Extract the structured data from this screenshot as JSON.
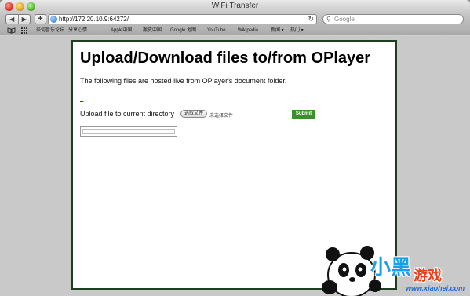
{
  "window": {
    "title": "WiFi Transfer"
  },
  "toolbar": {
    "url": "http://172.20.10.9:64272/",
    "search_placeholder": "Google",
    "add_label": "+"
  },
  "bookmarks": [
    "奈何音乐论坛...分享心情......",
    "Apple中国",
    "搬皮中国",
    "Google 地图",
    "YouTube",
    "Wikipedia",
    "新闻 ▾",
    "热门 ▾"
  ],
  "page": {
    "heading": "Upload/Download files to/from OPlayer",
    "intro": "The following files are hosted live from OPlayer's document folder.",
    "parent_link": "..",
    "upload_label": "Upload file to current directory",
    "choose_file_label": "选取文件",
    "no_file_label": "未选择文件",
    "submit_label": "Submit"
  },
  "watermark": {
    "brand": "小黑",
    "brand2": "游戏",
    "site": "www.xiaohei.com"
  },
  "colors": {
    "submit": "#3b8f2c",
    "page_border": "#1f3d1f",
    "link": "#1a3fd0"
  }
}
